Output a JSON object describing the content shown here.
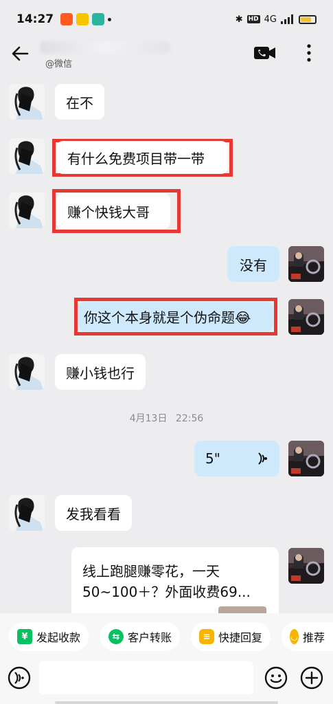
{
  "status": {
    "time": "14:27",
    "network": "4G"
  },
  "header": {
    "subtitle": "@微信"
  },
  "messages": [
    {
      "text": "在不"
    },
    {
      "text": "有什么免费项目带一带"
    },
    {
      "text": "赚个快钱大哥"
    },
    {
      "text": "没有"
    },
    {
      "text": "你这个本身就是个伪命题😂"
    },
    {
      "text": "赚小钱也行"
    },
    {
      "text": "5\""
    },
    {
      "text": "发我看看"
    }
  ],
  "timestamp": {
    "date": "4月13日",
    "time": "22:56"
  },
  "card": {
    "line1": "线上跑腿赚零花，一天",
    "line2": "50~100＋？外面收费69..."
  },
  "quick_actions": [
    {
      "label": "发起收款",
      "icon": "yen-icon",
      "color": "#07c160"
    },
    {
      "label": "客户转账",
      "icon": "transfer-icon",
      "color": "#07c160"
    },
    {
      "label": "快捷回复",
      "icon": "reply-icon",
      "color": "#f7b500"
    },
    {
      "label": "推荐",
      "icon": "recommend-icon",
      "color": "#f7b500"
    }
  ],
  "colors": {
    "outgoing_bubble": "#cde9fb",
    "incoming_bubble": "#ffffff",
    "highlight_frame": "#e53935",
    "background": "#ededf0"
  }
}
